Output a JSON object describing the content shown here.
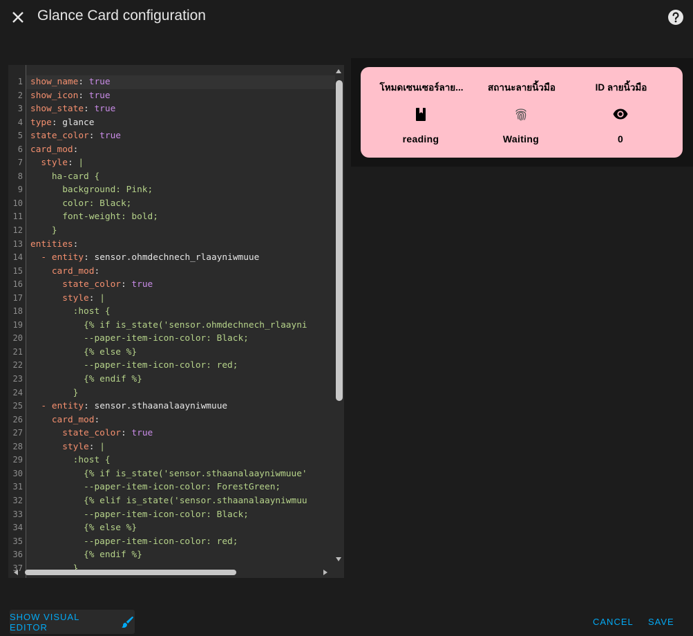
{
  "dialog": {
    "title": "Glance Card configuration",
    "close_icon": "close-icon",
    "help_icon": "help-circle-icon"
  },
  "editor": {
    "line_numbers": [
      "1",
      "2",
      "3",
      "4",
      "5",
      "6",
      "7",
      "8",
      "9",
      "10",
      "11",
      "12",
      "13",
      "14",
      "15",
      "16",
      "17",
      "18",
      "19",
      "20",
      "21",
      "22",
      "23",
      "24",
      "25",
      "26",
      "27",
      "28",
      "29",
      "30",
      "31",
      "32",
      "33",
      "34",
      "35",
      "36",
      "37"
    ],
    "lines": [
      "show_name: true",
      "show_icon: true",
      "show_state: true",
      "type: glance",
      "state_color: true",
      "card_mod:",
      "  style: |",
      "    ha-card {",
      "      background: Pink;",
      "      color: Black;",
      "      font-weight: bold;",
      "    }",
      "entities:",
      "  - entity: sensor.ohmdechnech_rlaayniwmuue",
      "    card_mod:",
      "      state_color: true",
      "      style: |",
      "        :host {",
      "          {% if is_state('sensor.ohmdechnech_rlaayni",
      "          --paper-item-icon-color: Black;",
      "          {% else %}",
      "          --paper-item-icon-color: red;",
      "          {% endif %}",
      "        }",
      "  - entity: sensor.sthaanalaayniwmuue",
      "    card_mod:",
      "      state_color: true",
      "      style: |",
      "        :host {",
      "          {% if is_state('sensor.sthaanalaayniwmuue'",
      "          --paper-item-icon-color: ForestGreen;",
      "          {% elif is_state('sensor.sthaanalaayniwmuu",
      "          --paper-item-icon-color: Black;",
      "          {% else %}",
      "          --paper-item-icon-color: red;",
      "          {% endif %}",
      "        }"
    ]
  },
  "preview": {
    "card_background": "#ffc0cb",
    "entities": [
      {
        "name": "โหมดเซนเซอร์ลาย...",
        "icon": "book-icon",
        "state": "reading"
      },
      {
        "name": "สถานะลายนิ้วมือ",
        "icon": "fingerprint-icon",
        "state": "Waiting"
      },
      {
        "name": "ID ลายนิ้วมือ",
        "icon": "eye-icon",
        "state": "0"
      }
    ]
  },
  "footer": {
    "visual_editor_label": "SHOW VISUAL EDITOR",
    "visual_editor_icon": "brush-icon",
    "cancel_label": "CANCEL",
    "save_label": "SAVE",
    "accent_color": "#03a9f4"
  }
}
